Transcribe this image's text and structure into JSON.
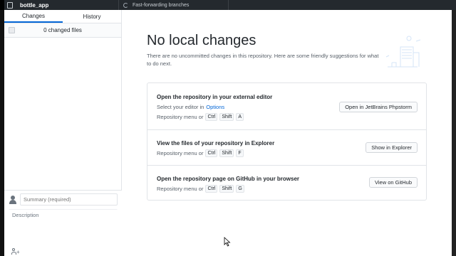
{
  "topbar": {
    "repo_name": "bottle_app",
    "fetch_text": "Fast-forwarding branches"
  },
  "sidebar": {
    "tabs": [
      {
        "label": "Changes",
        "active": true
      },
      {
        "label": "History",
        "active": false
      }
    ],
    "changed_files": "0 changed files",
    "summary_placeholder": "Summary (required)",
    "description_placeholder": "Description"
  },
  "main": {
    "title": "No local changes",
    "subtitle": "There are no uncommitted changes in this repository. Here are some friendly suggestions for what to do next.",
    "suggestions": [
      {
        "title": "Open the repository in your external editor",
        "line1_prefix": "Select your editor in",
        "line1_link": "Options",
        "menu_prefix": "Repository menu or",
        "keys": [
          "Ctrl",
          "Shift",
          "A"
        ],
        "button": "Open in JetBrains Phpstorm"
      },
      {
        "title": "View the files of your repository in Explorer",
        "menu_prefix": "Repository menu or",
        "keys": [
          "Ctrl",
          "Shift",
          "F"
        ],
        "button": "Show in Explorer"
      },
      {
        "title": "Open the repository page on GitHub in your browser",
        "menu_prefix": "Repository menu or",
        "keys": [
          "Ctrl",
          "Shift",
          "G"
        ],
        "button": "View on GitHub"
      }
    ]
  },
  "colors": {
    "topbar_bg": "#24292e",
    "accent": "#0366d6",
    "border": "#e1e4e8"
  }
}
